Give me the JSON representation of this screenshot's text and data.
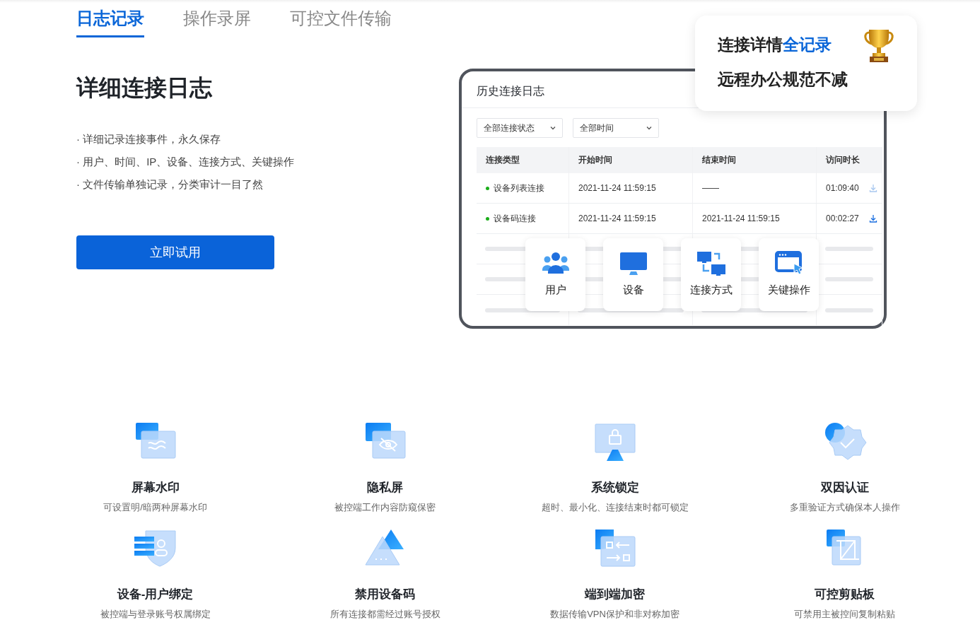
{
  "tabs": [
    {
      "label": "日志记录",
      "selected": true
    },
    {
      "label": "操作录屏",
      "selected": false
    },
    {
      "label": "可控文件传输",
      "selected": false
    }
  ],
  "intro": {
    "heading": "详细连接日志",
    "bullets": [
      "· 详细记录连接事件，永久保存",
      "· 用户、时间、IP、设备、连接方式、关键操作",
      "· 文件传输单独记录，分类审计一目了然"
    ],
    "button": "立即试用"
  },
  "log_panel": {
    "title": "历史连接日志",
    "filters": [
      {
        "value": "全部连接状态"
      },
      {
        "value": "全部时间"
      }
    ],
    "columns": [
      "连接类型",
      "开始时间",
      "结束时间",
      "访问时长"
    ],
    "rows": [
      {
        "type": "设备列表连接",
        "color": "#1aad19",
        "start": "2021-11-24 11:59:15",
        "end": "——",
        "duration": "01:09:40",
        "download_disabled": true
      },
      {
        "type": "设备码连接",
        "color": "#1aad19",
        "start": "2021-11-24 11:59:15",
        "end": "2021-11-24 11:59:15",
        "duration": "00:02:27",
        "download_disabled": false
      }
    ],
    "cards": [
      "用户",
      "设备",
      "连接方式",
      "关键操作"
    ]
  },
  "callout": {
    "title": [
      {
        "text": "连接详情",
        "highlight": false
      },
      {
        "text": "全记录",
        "highlight": true
      }
    ],
    "subtitle": "远程办公规范不减"
  },
  "features": [
    {
      "title": "屏幕水印",
      "desc": "可设置明/暗两种屏幕水印"
    },
    {
      "title": "隐私屏",
      "desc": "被控端工作内容防窥保密"
    },
    {
      "title": "系统锁定",
      "desc": "超时、最小化、连接结束时都可锁定"
    },
    {
      "title": "双因认证",
      "desc": "多重验证方式确保本人操作"
    },
    {
      "title": "设备-用户绑定",
      "desc": "被控端与登录账号权属绑定"
    },
    {
      "title": "禁用设备码",
      "desc": "所有连接都需经过账号授权"
    },
    {
      "title": "端到端加密",
      "desc": "数据传输VPN保护和非对称加密"
    },
    {
      "title": "可控剪贴板",
      "desc": "可禁用主被控间复制粘贴"
    }
  ]
}
